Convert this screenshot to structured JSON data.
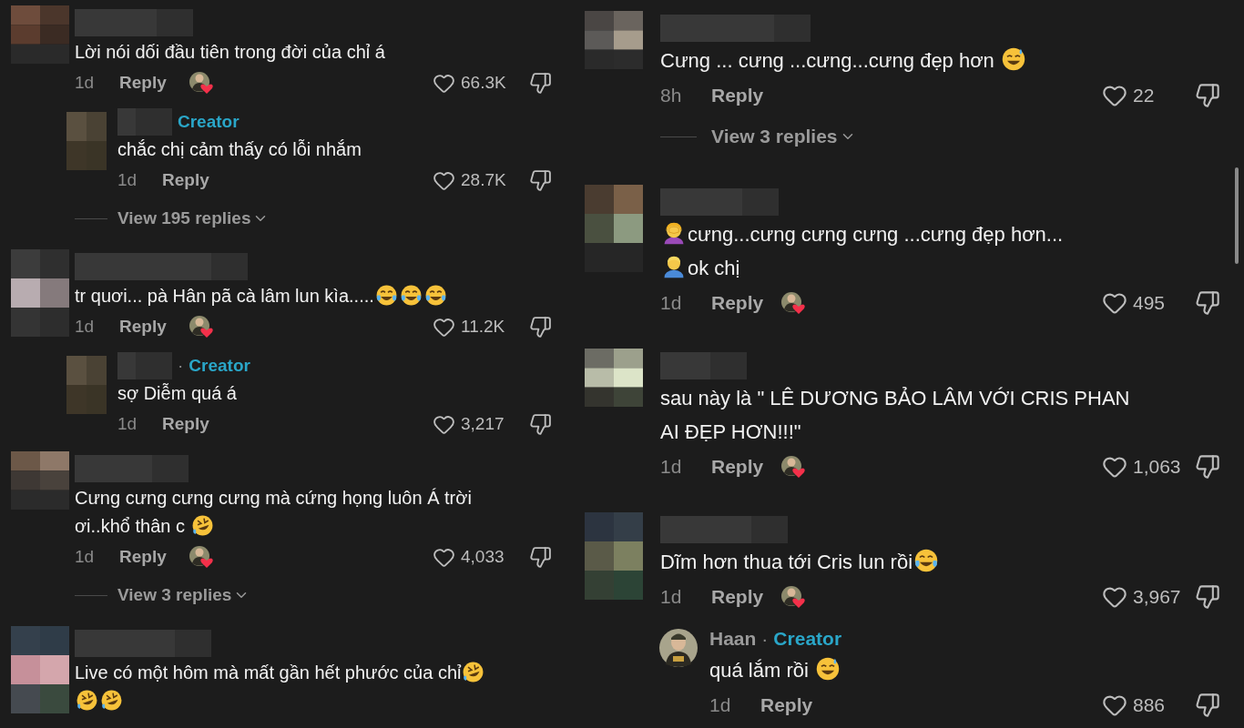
{
  "panels": [
    {
      "comments": [
        {
          "body": [
            {
              "kind": "text",
              "text": "Lời nói dối đầu tiên trong đời của chỉ á"
            }
          ],
          "time": "1d",
          "reply_label": "Reply",
          "liked_by_creator": true,
          "likes": "66.3K",
          "replies": [
            {
              "badge": "Creator",
              "body": [
                {
                  "kind": "text",
                  "text": "chắc chị cảm thấy có lỗi nhắm"
                }
              ],
              "time": "1d",
              "reply_label": "Reply",
              "liked_by_creator": false,
              "likes": "28.7K"
            }
          ],
          "view_replies": "View 195 replies"
        },
        {
          "body": [
            {
              "kind": "text",
              "text": "tr quơi... pà Hân pã cà lâm lun kìa....."
            },
            {
              "kind": "joy"
            },
            {
              "kind": "joy"
            },
            {
              "kind": "joy"
            }
          ],
          "time": "1d",
          "reply_label": "Reply",
          "liked_by_creator": true,
          "likes": "11.2K",
          "replies": [
            {
              "separator": "·",
              "badge": "Creator",
              "body": [
                {
                  "kind": "text",
                  "text": "sợ Diễm quá á"
                }
              ],
              "time": "1d",
              "reply_label": "Reply",
              "liked_by_creator": false,
              "likes": "3,217"
            }
          ]
        },
        {
          "body": [
            {
              "kind": "text",
              "text": "Cưng cưng cưng cưng mà cứng họng luôn Á trời"
            },
            {
              "kind": "break"
            },
            {
              "kind": "text",
              "text": "ơi..khổ thân c "
            },
            {
              "kind": "rofl"
            }
          ],
          "time": "1d",
          "reply_label": "Reply",
          "liked_by_creator": true,
          "likes": "4,033",
          "view_replies": "View 3 replies"
        },
        {
          "body": [
            {
              "kind": "text",
              "text": "Live có một hôm mà mất gần hết phước của chỉ"
            },
            {
              "kind": "rofl"
            },
            {
              "kind": "break"
            },
            {
              "kind": "rofl"
            },
            {
              "kind": "rofl"
            }
          ]
        }
      ]
    },
    {
      "comments": [
        {
          "body": [
            {
              "kind": "text",
              "text": "Cưng ... cưng ...cưng...cưng đẹp hơn "
            },
            {
              "kind": "sweat"
            }
          ],
          "time": "8h",
          "reply_label": "Reply",
          "liked_by_creator": false,
          "likes": "22",
          "view_replies": "View 3 replies"
        },
        {
          "body": [
            {
              "kind": "facepalm"
            },
            {
              "kind": "text",
              "text": "cưng...cưng cưng cưng ...cưng đẹp hơn..."
            },
            {
              "kind": "break"
            },
            {
              "kind": "man"
            },
            {
              "kind": "text",
              "text": "ok chị"
            }
          ],
          "time": "1d",
          "reply_label": "Reply",
          "liked_by_creator": true,
          "likes": "495"
        },
        {
          "body": [
            {
              "kind": "text",
              "text": "sau này là \" LÊ DƯƠNG BẢO LÂM VỚI CRIS PHAN"
            },
            {
              "kind": "break"
            },
            {
              "kind": "text",
              "text": "AI ĐẸP HƠN!!!\""
            }
          ],
          "time": "1d",
          "reply_label": "Reply",
          "liked_by_creator": true,
          "likes": "1,063"
        },
        {
          "body": [
            {
              "kind": "text",
              "text": "Dĩm hơn thua tới Cris lun rồi"
            },
            {
              "kind": "joy"
            }
          ],
          "time": "1d",
          "reply_label": "Reply",
          "liked_by_creator": true,
          "likes": "3,967",
          "replies": [
            {
              "name": "Haan",
              "separator": "·",
              "badge": "Creator",
              "round_avatar": true,
              "body": [
                {
                  "kind": "text",
                  "text": "quá lắm rồi "
                },
                {
                  "kind": "sweat"
                }
              ],
              "time": "1d",
              "reply_label": "Reply",
              "liked_by_creator": false,
              "likes": "886"
            }
          ]
        }
      ]
    }
  ]
}
